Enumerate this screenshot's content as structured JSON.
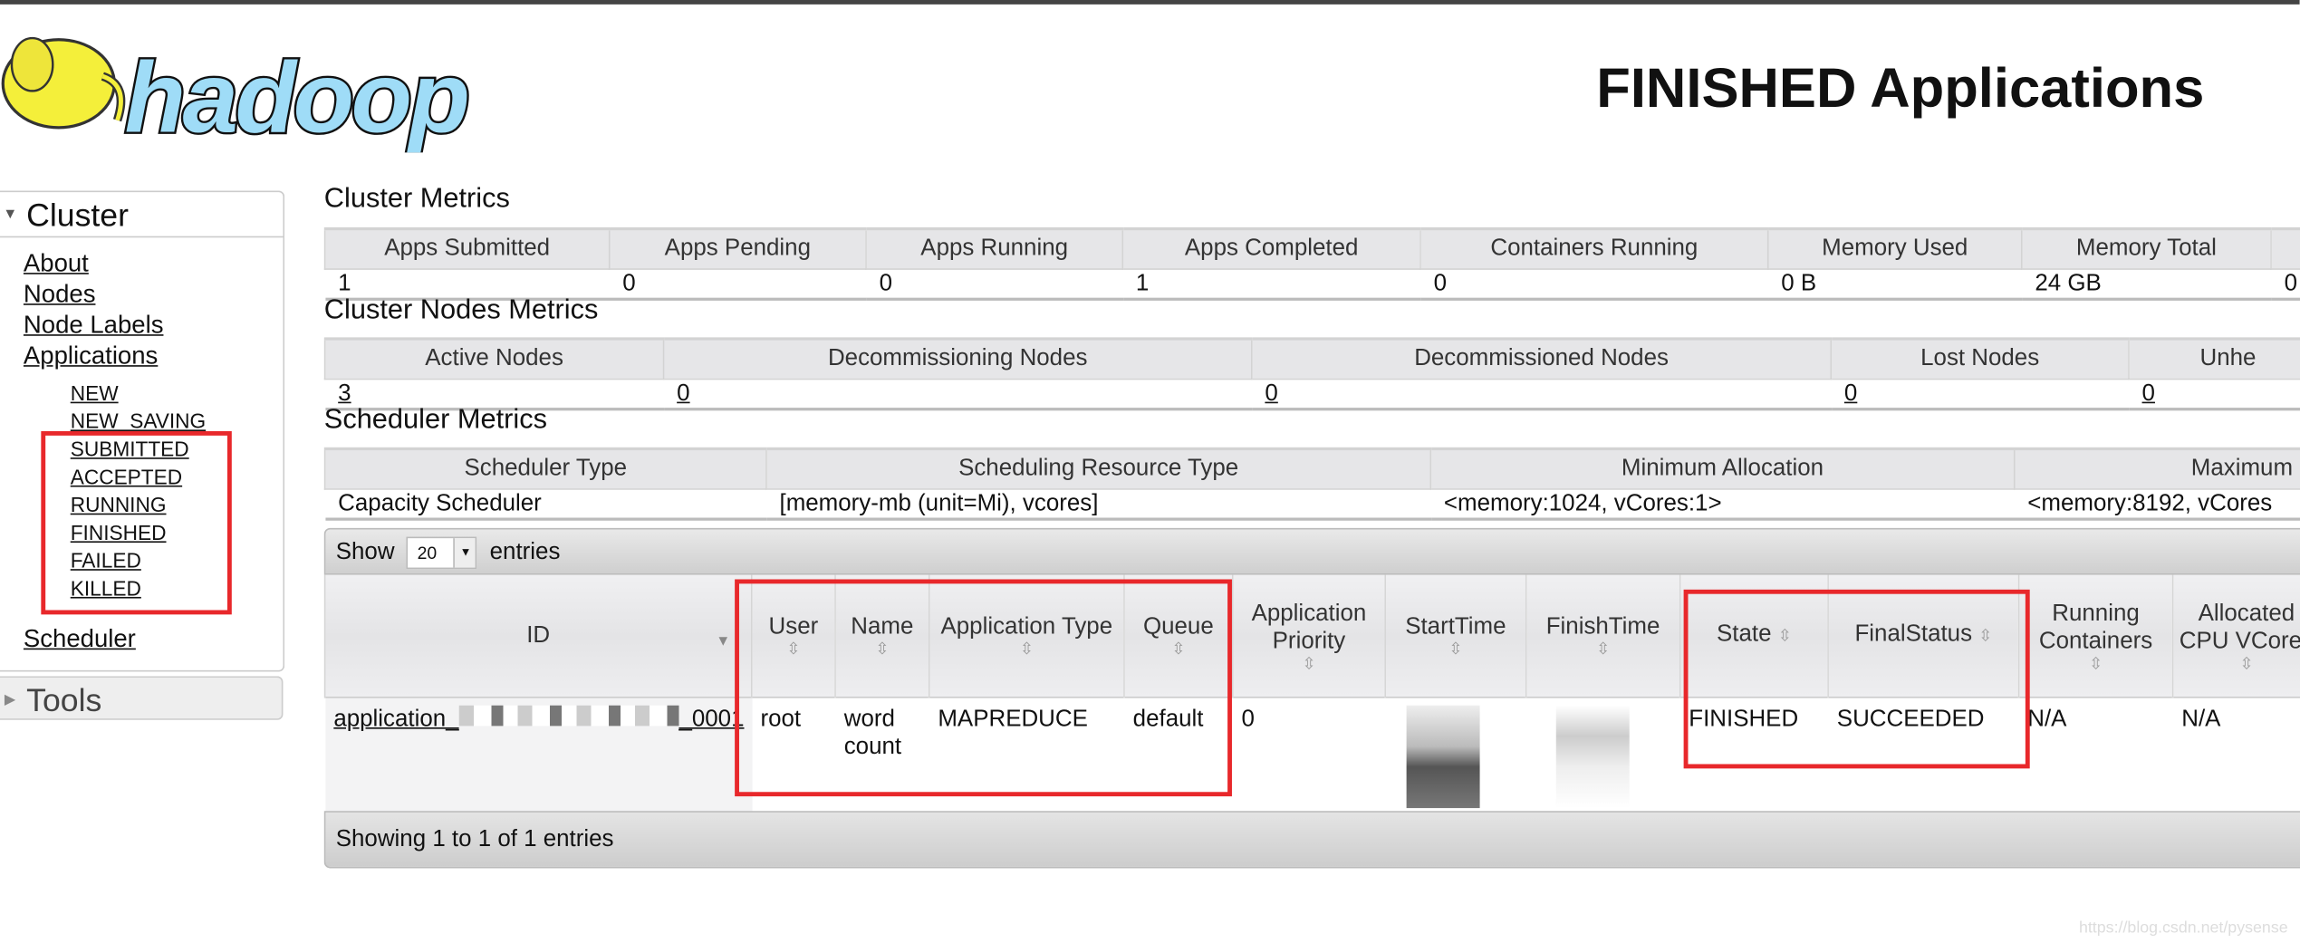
{
  "header": {
    "logo_text": "hadoop",
    "title": "FINISHED Applications"
  },
  "sidebar": {
    "cluster_label": "Cluster",
    "links": [
      "About",
      "Nodes",
      "Node Labels",
      "Applications"
    ],
    "app_states": [
      "NEW",
      "NEW_SAVING",
      "SUBMITTED",
      "ACCEPTED",
      "RUNNING",
      "FINISHED",
      "FAILED",
      "KILLED"
    ],
    "scheduler_label": "Scheduler",
    "tools_label": "Tools"
  },
  "cluster_metrics": {
    "title": "Cluster Metrics",
    "headers": [
      "Apps Submitted",
      "Apps Pending",
      "Apps Running",
      "Apps Completed",
      "Containers Running",
      "Memory Used",
      "Memory Total",
      ""
    ],
    "values": [
      "1",
      "0",
      "0",
      "1",
      "0",
      "0 B",
      "24 GB",
      "0"
    ]
  },
  "cluster_nodes_metrics": {
    "title": "Cluster Nodes Metrics",
    "headers": [
      "Active Nodes",
      "Decommissioning Nodes",
      "Decommissioned Nodes",
      "Lost Nodes",
      "Unhe"
    ],
    "values": [
      "3",
      "0",
      "0",
      "0",
      "0"
    ]
  },
  "scheduler_metrics": {
    "title": "Scheduler Metrics",
    "headers": [
      "Scheduler Type",
      "Scheduling Resource Type",
      "Minimum Allocation",
      "Maximum"
    ],
    "values": [
      "Capacity Scheduler",
      "[memory-mb (unit=Mi), vcores]",
      "<memory:1024, vCores:1>",
      "<memory:8192, vCores"
    ]
  },
  "apps_table": {
    "show_label": "Show",
    "page_size": "20",
    "entries_label": "entries",
    "headers": [
      "ID",
      "User",
      "Name",
      "Application Type",
      "Queue",
      "Application Priority",
      "StartTime",
      "FinishTime",
      "State",
      "FinalStatus",
      "Running Containers",
      "Allocated CPU VCores"
    ],
    "rows": [
      {
        "id_prefix": "application_",
        "id_suffix": "_0001",
        "user": "root",
        "name": "word count",
        "type": "MAPREDUCE",
        "queue": "default",
        "priority": "0",
        "start_time": "",
        "finish_time": "",
        "state": "FINISHED",
        "final_status": "SUCCEEDED",
        "running_containers": "N/A",
        "allocated_vcores": "N/A"
      }
    ],
    "footer": "Showing 1 to 1 of 1 entries"
  },
  "annotation_color": "#e8282b",
  "watermark": "https://blog.csdn.net/pysense"
}
